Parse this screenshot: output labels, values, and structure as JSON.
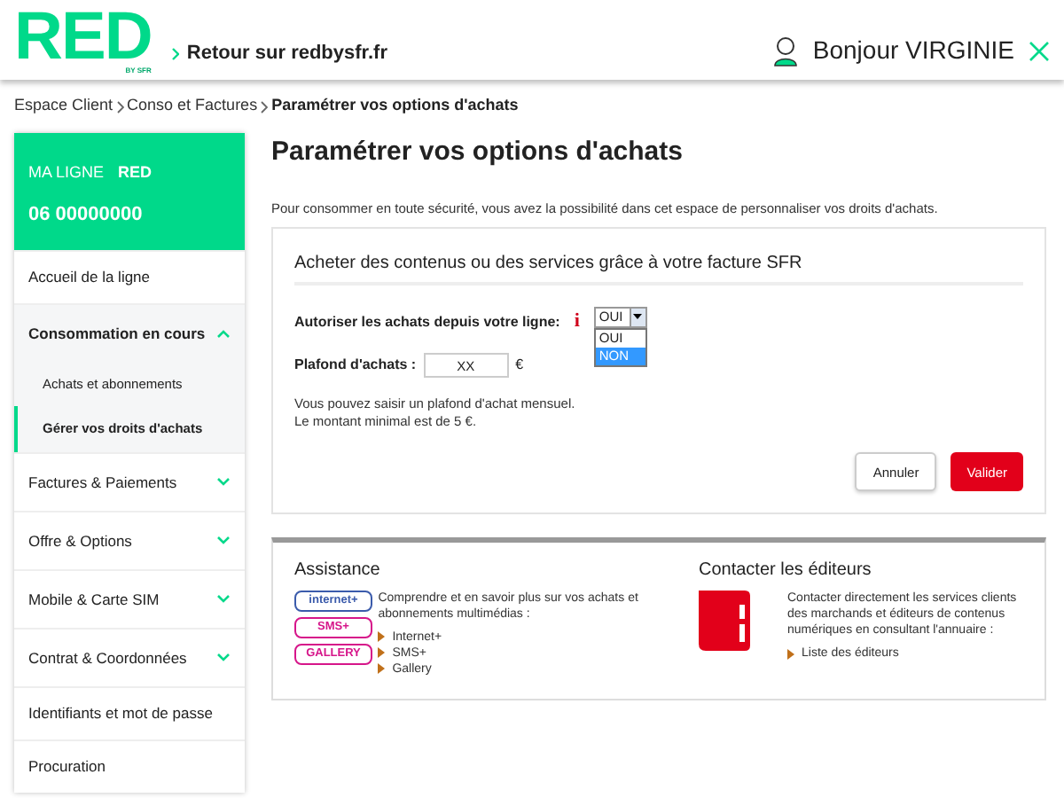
{
  "header": {
    "logo": "RED",
    "logo_sub": "BY SFR",
    "back_link": "Retour sur redbysfr.fr",
    "greeting": "Bonjour VIRGINIE"
  },
  "breadcrumb": [
    {
      "label": "Espace Client",
      "current": false
    },
    {
      "label": "Conso et Factures",
      "current": false
    },
    {
      "label": "Paramétrer vos options d'achats",
      "current": true
    }
  ],
  "sidebar": {
    "line_label": "MA LIGNE",
    "line_brand": "RED",
    "line_number": "06 00000000",
    "items": [
      {
        "label": "Accueil de la ligne",
        "kind": "link"
      },
      {
        "label": "Consommation en cours",
        "kind": "group",
        "expanded": true,
        "children": [
          {
            "label": "Achats et abonnements",
            "selected": false
          },
          {
            "label": "Gérer vos droits d'achats",
            "selected": true
          }
        ]
      },
      {
        "label": "Factures & Paiements",
        "kind": "group",
        "expanded": false
      },
      {
        "label": "Offre & Options",
        "kind": "group",
        "expanded": false
      },
      {
        "label": "Mobile & Carte SIM",
        "kind": "group",
        "expanded": false
      },
      {
        "label": "Contrat & Coordonnées",
        "kind": "group",
        "expanded": false
      },
      {
        "label": "Identifiants et mot de passe",
        "kind": "link"
      },
      {
        "label": "Procuration",
        "kind": "link"
      }
    ]
  },
  "page": {
    "title": "Paramétrer vos options d'achats",
    "intro": "Pour consommer en toute sécurité, vous avez la possibilité dans cet espace de personnaliser vos droits d'achats.",
    "form": {
      "heading": "Acheter des contenus ou des services grâce à votre facture SFR",
      "allow_label": "Autoriser les achats depuis votre ligne:",
      "info_icon": "i",
      "allow_value": "OUI",
      "options": [
        {
          "label": "OUI",
          "selected": false
        },
        {
          "label": "NON",
          "selected": true
        }
      ],
      "limit_label": "Plafond d'achats :",
      "limit_value": "XX",
      "currency": "€",
      "help": [
        "Vous pouvez saisir un plafond d'achat mensuel.",
        "Le montant minimal est de 5 €."
      ],
      "buttons": [
        {
          "label": "Annuler",
          "kind": "secondary"
        },
        {
          "label": "Valider",
          "kind": "primary"
        }
      ]
    },
    "assistance": {
      "title": "Assistance",
      "badges": [
        {
          "label": "internet+",
          "color": "#3b5bab"
        },
        {
          "label": "SMS+",
          "color": "#d6168a"
        },
        {
          "label": "GALLERY",
          "color": "#d6168a"
        }
      ],
      "text": "Comprendre et en savoir plus sur vos achats et abonnements multimédias :",
      "links": [
        "Internet+",
        "SMS+",
        "Gallery"
      ]
    },
    "publishers": {
      "title": "Contacter les éditeurs",
      "text": "Contacter directement les services clients des marchands et éditeurs de contenus numériques en consultant l'annuaire :",
      "links": [
        "Liste des éditeurs"
      ]
    }
  }
}
